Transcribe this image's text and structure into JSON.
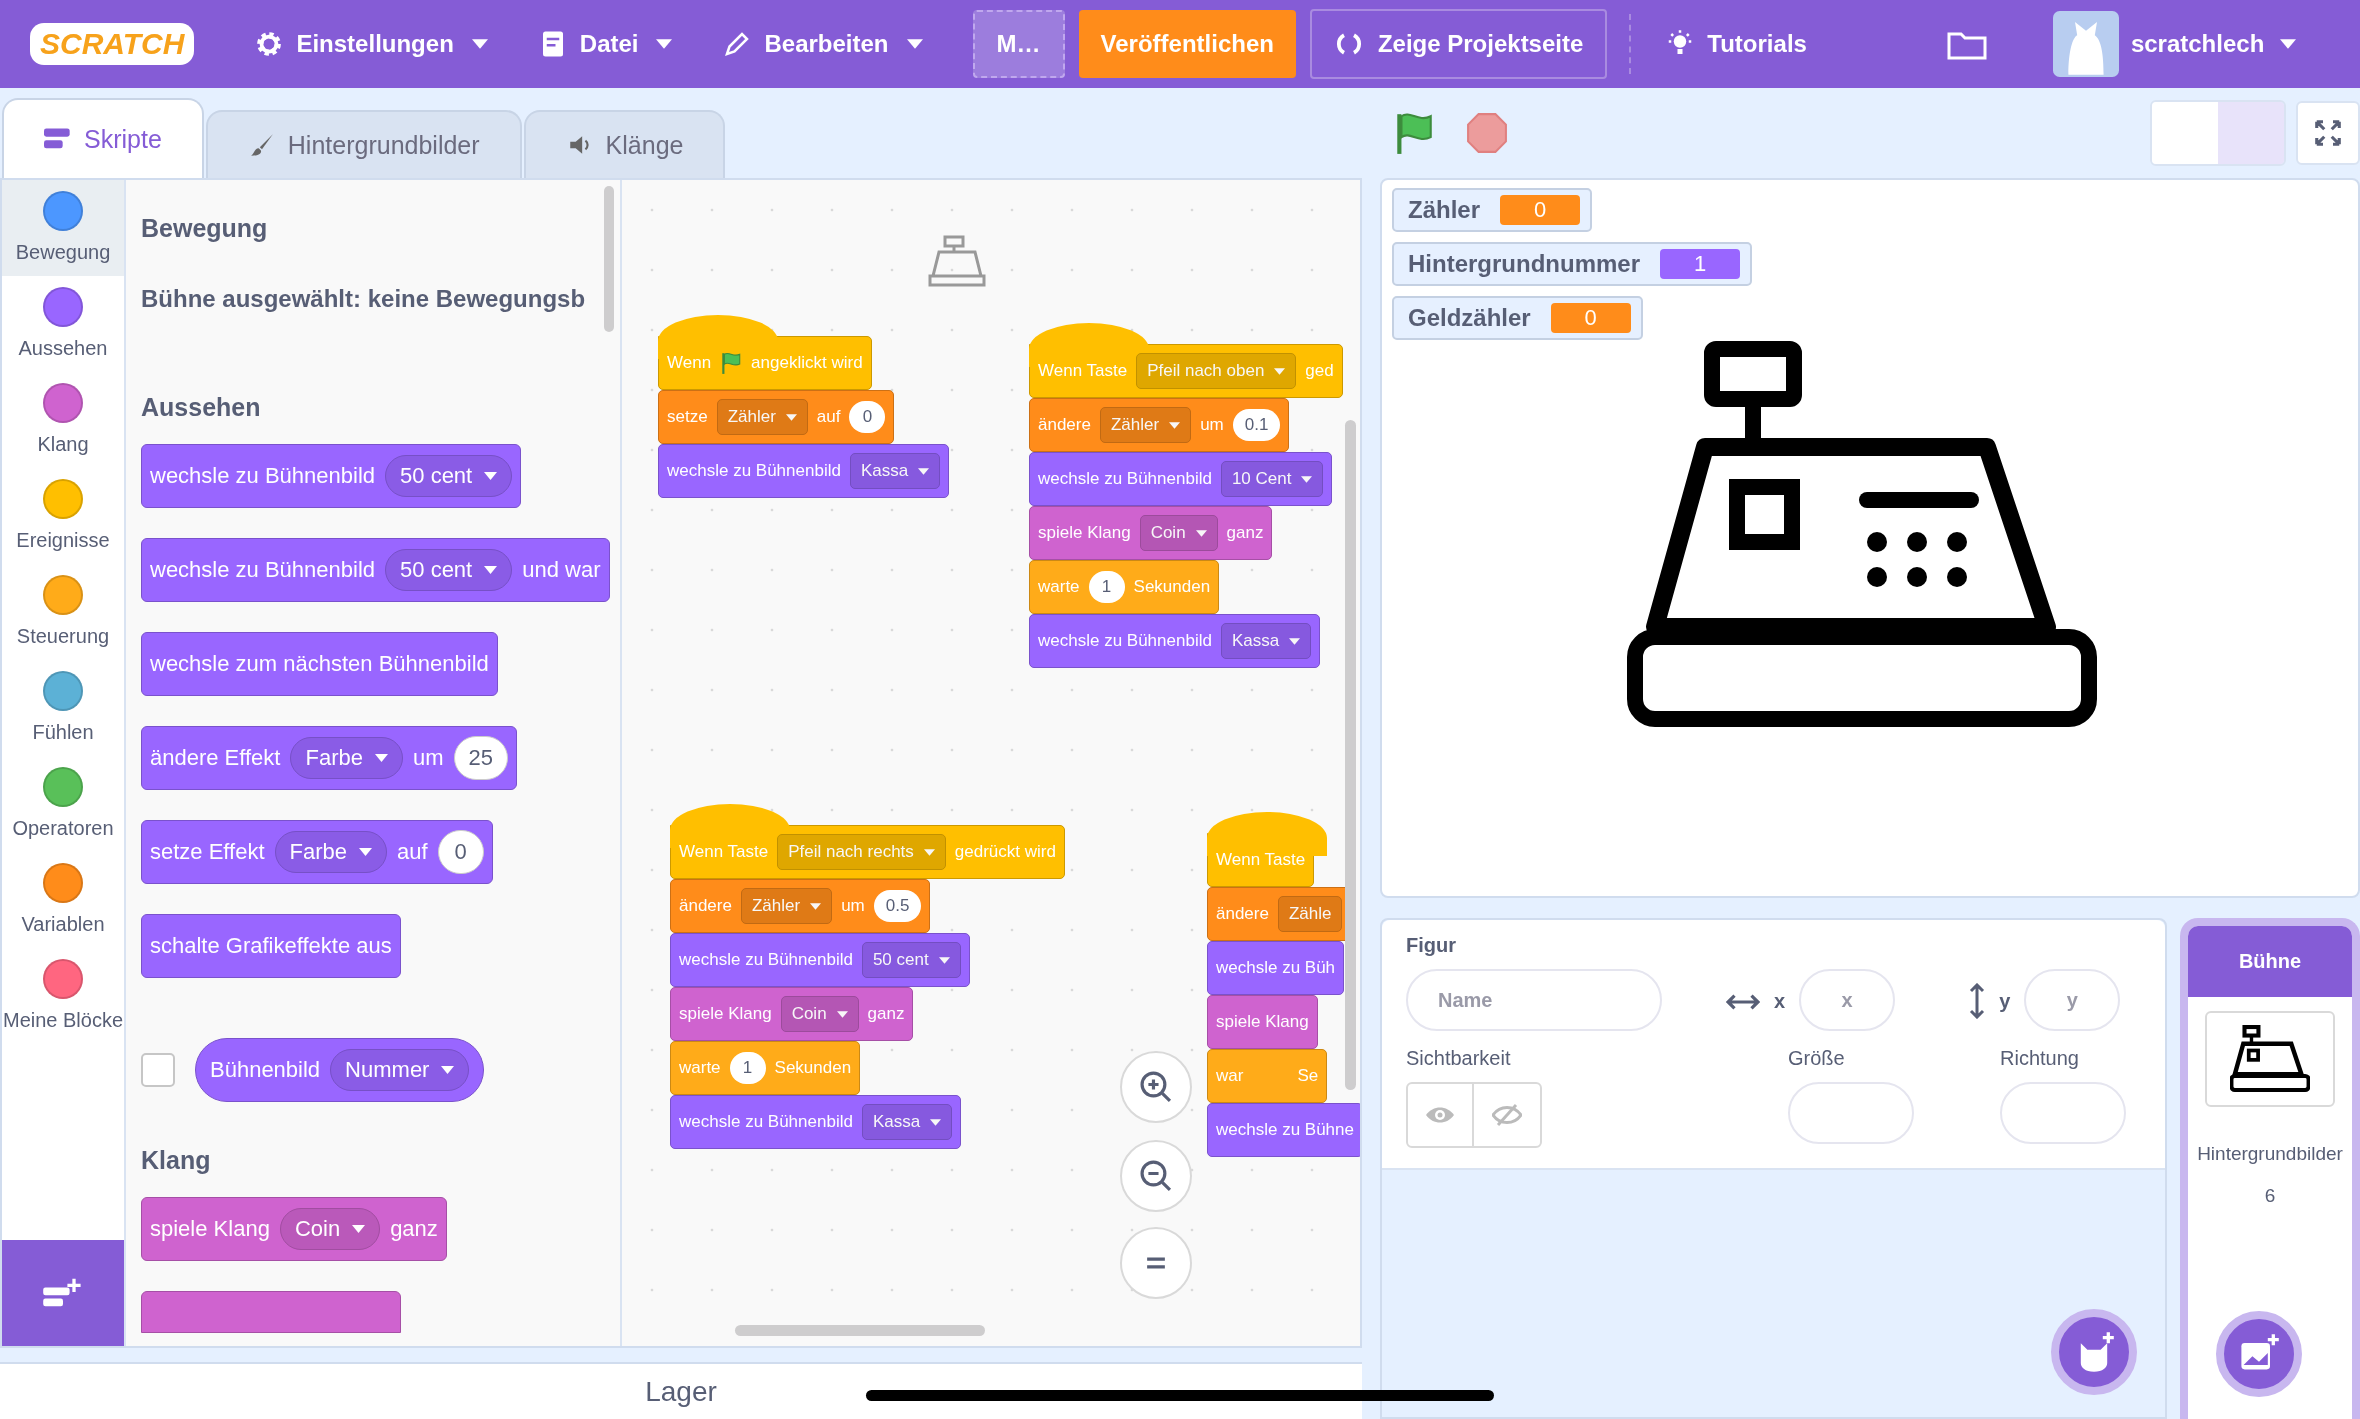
{
  "menu": {
    "logo": "SCRATCH",
    "items": [
      {
        "label": "Einstellungen",
        "kind": "gear"
      },
      {
        "label": "Datei",
        "kind": "file"
      },
      {
        "label": "Bearbeiten",
        "kind": "pencil"
      }
    ],
    "title_field": "M…",
    "publish": "Veröffentlichen",
    "project_page": "Zeige Projektseite",
    "tutorials": "Tutorials",
    "user": "scratchlech"
  },
  "tabs": [
    {
      "label": "Skripte",
      "selected": true
    },
    {
      "label": "Hintergrundbilder",
      "selected": false
    },
    {
      "label": "Klänge",
      "selected": false
    }
  ],
  "categories": [
    {
      "label": "Bewegung",
      "color": "#4c97ff",
      "selected": true
    },
    {
      "label": "Aussehen",
      "color": "#9966ff",
      "selected": false
    },
    {
      "label": "Klang",
      "color": "#cf63cf",
      "selected": false
    },
    {
      "label": "Ereignisse",
      "color": "#ffbf00",
      "selected": false
    },
    {
      "label": "Steuerung",
      "color": "#ffab19",
      "selected": false
    },
    {
      "label": "Fühlen",
      "color": "#5cb1d6",
      "selected": false
    },
    {
      "label": "Operatoren",
      "color": "#59c059",
      "selected": false
    },
    {
      "label": "Variablen",
      "color": "#ff8c1a",
      "selected": false
    },
    {
      "label": "Meine Blöcke",
      "color": "#ff6680",
      "selected": false
    }
  ],
  "palette": [
    {
      "kind": "heading",
      "text": "Bewegung"
    },
    {
      "kind": "note",
      "text": "Bühne ausgewählt: keine Bewegungsb"
    },
    {
      "kind": "heading",
      "text": "Aussehen"
    },
    {
      "kind": "block",
      "color": "#9966ff",
      "parts": [
        {
          "kind": "text",
          "text": "wechsle zu Bühnenbild"
        },
        {
          "kind": "menu",
          "text": "50 cent"
        }
      ]
    },
    {
      "kind": "block",
      "color": "#9966ff",
      "parts": [
        {
          "kind": "text",
          "text": "wechsle zu Bühnenbild"
        },
        {
          "kind": "menu",
          "text": "50 cent"
        },
        {
          "kind": "text",
          "text": "und war"
        }
      ]
    },
    {
      "kind": "block",
      "color": "#9966ff",
      "parts": [
        {
          "kind": "text",
          "text": "wechsle zum nächsten Bühnenbild"
        }
      ]
    },
    {
      "kind": "block",
      "color": "#9966ff",
      "parts": [
        {
          "kind": "text",
          "text": "ändere Effekt"
        },
        {
          "kind": "menu",
          "text": "Farbe"
        },
        {
          "kind": "text",
          "text": "um"
        },
        {
          "kind": "input",
          "text": "25"
        }
      ]
    },
    {
      "kind": "block",
      "color": "#9966ff",
      "parts": [
        {
          "kind": "text",
          "text": "setze Effekt"
        },
        {
          "kind": "menu",
          "text": "Farbe"
        },
        {
          "kind": "text",
          "text": "auf"
        },
        {
          "kind": "input",
          "text": "0"
        }
      ]
    },
    {
      "kind": "block",
      "color": "#9966ff",
      "parts": [
        {
          "kind": "text",
          "text": "schalte Grafikeffekte aus"
        }
      ]
    },
    {
      "kind": "reporter",
      "color": "#9966ff",
      "checked": false,
      "parts": [
        {
          "kind": "text",
          "text": "Bühnenbild"
        },
        {
          "kind": "menu",
          "text": "Nummer"
        }
      ]
    },
    {
      "kind": "heading",
      "text": "Klang"
    },
    {
      "kind": "block",
      "color": "#cf63cf",
      "parts": [
        {
          "kind": "text",
          "text": "spiele Klang"
        },
        {
          "kind": "menu",
          "text": "Coin"
        },
        {
          "kind": "text",
          "text": "ganz"
        }
      ]
    },
    {
      "kind": "cut-block",
      "color": "#cf63cf"
    }
  ],
  "stacks": [
    [
      {
        "kind": "hat",
        "color": "#ffbf00",
        "parts": [
          {
            "kind": "text",
            "text": "Wenn"
          },
          {
            "kind": "flag"
          },
          {
            "kind": "text",
            "text": "angeklickt wird"
          }
        ]
      },
      {
        "kind": "stack",
        "color": "#ff8c1a",
        "parts": [
          {
            "kind": "text",
            "text": "setze"
          },
          {
            "kind": "menu",
            "text": "Zähler"
          },
          {
            "kind": "text",
            "text": "auf"
          },
          {
            "kind": "input",
            "text": "0"
          }
        ]
      },
      {
        "kind": "stack",
        "color": "#9966ff",
        "parts": [
          {
            "kind": "text",
            "text": "wechsle zu Bühnenbild"
          },
          {
            "kind": "menu",
            "text": "Kassa"
          }
        ]
      }
    ],
    [
      {
        "kind": "hat",
        "color": "#ffbf00",
        "parts": [
          {
            "kind": "text",
            "text": "Wenn Taste"
          },
          {
            "kind": "menu",
            "text": "Pfeil nach oben"
          },
          {
            "kind": "text",
            "text": "ged"
          }
        ]
      },
      {
        "kind": "stack",
        "color": "#ff8c1a",
        "parts": [
          {
            "kind": "text",
            "text": "ändere"
          },
          {
            "kind": "menu",
            "text": "Zähler"
          },
          {
            "kind": "text",
            "text": "um"
          },
          {
            "kind": "input",
            "text": "0.1"
          }
        ]
      },
      {
        "kind": "stack",
        "color": "#9966ff",
        "parts": [
          {
            "kind": "text",
            "text": "wechsle zu Bühnenbild"
          },
          {
            "kind": "menu",
            "text": "10 Cent"
          }
        ]
      },
      {
        "kind": "stack",
        "color": "#cf63cf",
        "parts": [
          {
            "kind": "text",
            "text": "spiele Klang"
          },
          {
            "kind": "menu",
            "text": "Coin"
          },
          {
            "kind": "text",
            "text": "ganz"
          }
        ]
      },
      {
        "kind": "stack",
        "color": "#ffab19",
        "parts": [
          {
            "kind": "text",
            "text": "warte"
          },
          {
            "kind": "input",
            "text": "1"
          },
          {
            "kind": "text",
            "text": "Sekunden"
          }
        ]
      },
      {
        "kind": "stack",
        "color": "#9966ff",
        "parts": [
          {
            "kind": "text",
            "text": "wechsle zu Bühnenbild"
          },
          {
            "kind": "menu",
            "text": "Kassa"
          }
        ]
      }
    ],
    [
      {
        "kind": "hat",
        "color": "#ffbf00",
        "parts": [
          {
            "kind": "text",
            "text": "Wenn Taste"
          },
          {
            "kind": "menu",
            "text": "Pfeil nach rechts"
          },
          {
            "kind": "text",
            "text": "gedrückt wird"
          }
        ]
      },
      {
        "kind": "stack",
        "color": "#ff8c1a",
        "parts": [
          {
            "kind": "text",
            "text": "ändere"
          },
          {
            "kind": "menu",
            "text": "Zähler"
          },
          {
            "kind": "text",
            "text": "um"
          },
          {
            "kind": "input",
            "text": "0.5"
          }
        ]
      },
      {
        "kind": "stack",
        "color": "#9966ff",
        "parts": [
          {
            "kind": "text",
            "text": "wechsle zu Bühnenbild"
          },
          {
            "kind": "menu",
            "text": "50 cent"
          }
        ]
      },
      {
        "kind": "stack",
        "color": "#cf63cf",
        "parts": [
          {
            "kind": "text",
            "text": "spiele Klang"
          },
          {
            "kind": "menu",
            "text": "Coin"
          },
          {
            "kind": "text",
            "text": "ganz"
          }
        ]
      },
      {
        "kind": "stack",
        "color": "#ffab19",
        "parts": [
          {
            "kind": "text",
            "text": "warte"
          },
          {
            "kind": "input",
            "text": "1"
          },
          {
            "kind": "text",
            "text": "Sekunden"
          }
        ]
      },
      {
        "kind": "stack",
        "color": "#9966ff",
        "parts": [
          {
            "kind": "text",
            "text": "wechsle zu Bühnenbild"
          },
          {
            "kind": "menu",
            "text": "Kassa"
          }
        ]
      }
    ],
    [
      {
        "kind": "hat",
        "color": "#ffbf00",
        "parts": [
          {
            "kind": "text",
            "text": "Wenn Taste"
          }
        ]
      },
      {
        "kind": "stack",
        "color": "#ff8c1a",
        "parts": [
          {
            "kind": "text",
            "text": "ändere"
          },
          {
            "kind": "field",
            "text": "Zähle"
          }
        ]
      },
      {
        "kind": "stack",
        "color": "#9966ff",
        "parts": [
          {
            "kind": "text",
            "text": "wechsle zu Büh"
          }
        ]
      },
      {
        "kind": "stack",
        "color": "#cf63cf",
        "parts": [
          {
            "kind": "text",
            "text": "spiele Klang"
          }
        ]
      },
      {
        "kind": "stack",
        "color": "#ffab19",
        "parts": [
          {
            "kind": "text",
            "text": "war"
          },
          {
            "kind": "covered"
          },
          {
            "kind": "text",
            "text": "Se"
          }
        ]
      },
      {
        "kind": "stack",
        "color": "#9966ff",
        "parts": [
          {
            "kind": "text",
            "text": "wechsle zu Bühne"
          }
        ]
      }
    ]
  ],
  "stage_modes": [
    {
      "selected": false
    },
    {
      "selected": true
    }
  ],
  "monitors": [
    {
      "label": "Zähler",
      "value": "0",
      "color": "#ff8c1a"
    },
    {
      "label": "Hintergrundnummer",
      "value": "1",
      "color": "#9966ff"
    },
    {
      "label": "Geldzähler",
      "value": "0",
      "color": "#ff8c1a"
    }
  ],
  "sprite_info": {
    "title": "Figur",
    "name_placeholder": "Name",
    "x_label": "x",
    "x_placeholder": "x",
    "y_label": "y",
    "y_placeholder": "y",
    "visibility": "Sichtbarkeit",
    "size": "Größe",
    "direction": "Richtung"
  },
  "stage_pane": {
    "title": "Bühne",
    "backdrops_label": "Hintergrundbilder",
    "backdrops_count": "6"
  },
  "backpack": "Lager"
}
